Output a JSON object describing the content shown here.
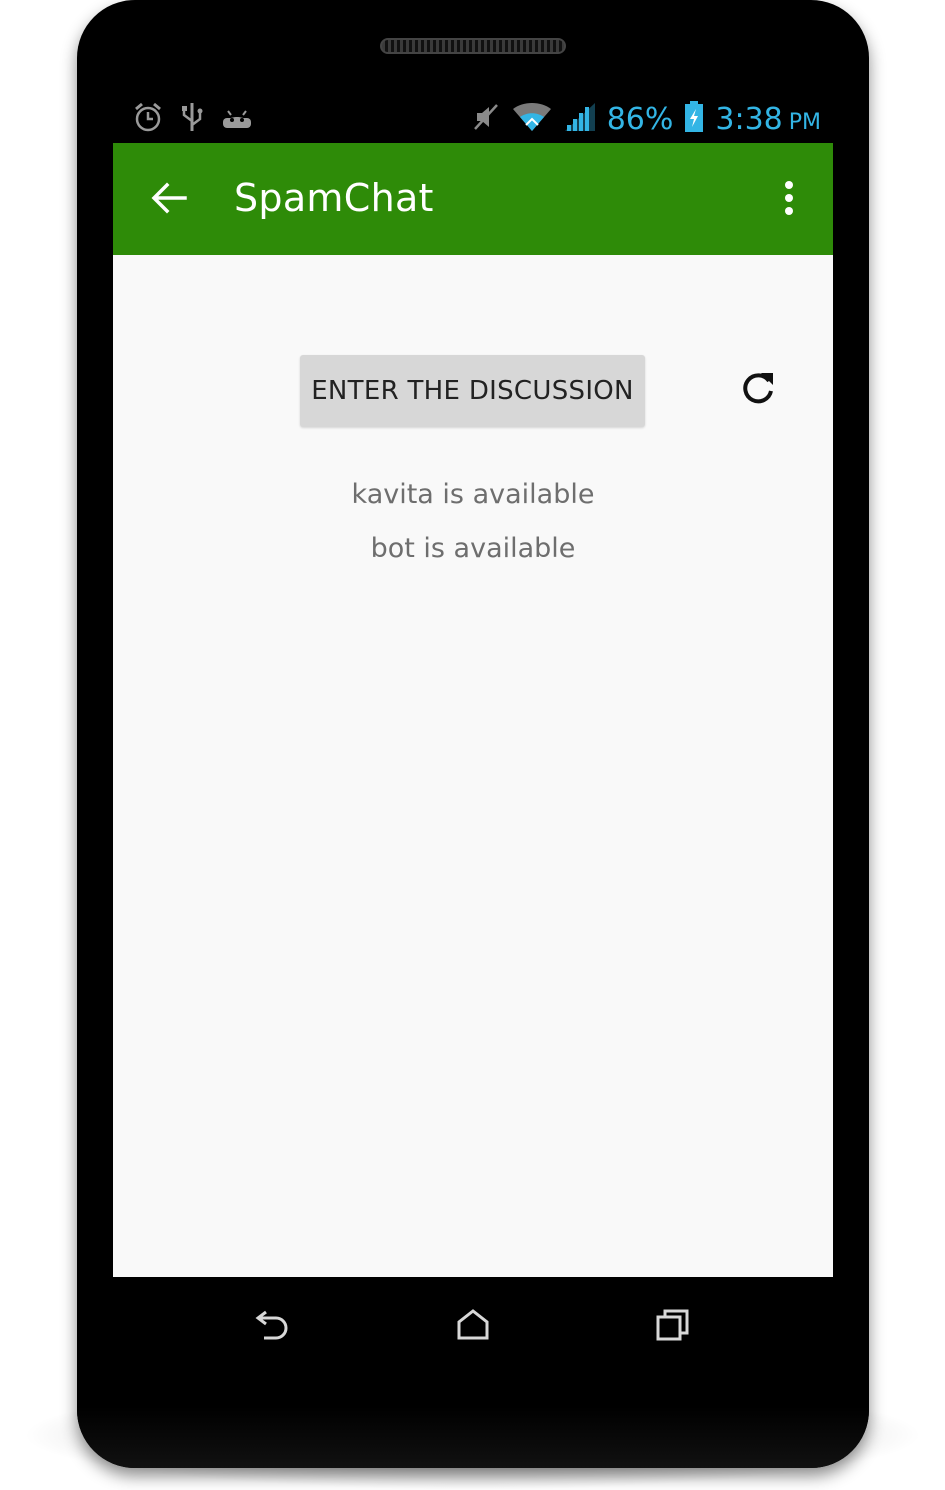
{
  "status_bar": {
    "left_icons": [
      "alarm-icon",
      "usb-icon",
      "android-debug-icon"
    ],
    "right_icons": [
      "mute-icon",
      "wifi-icon",
      "signal-icon",
      "battery-charging-icon"
    ],
    "battery_percent": "86%",
    "time": "3:38",
    "am_pm": "PM",
    "accent_color": "#33b5e5"
  },
  "app_bar": {
    "title": "SpamChat",
    "back_icon": "arrow-left-icon",
    "menu_icon": "more-vert-icon",
    "color": "#2e8b08"
  },
  "main": {
    "enter_button_label": "ENTER THE DISCUSSION",
    "refresh_icon": "refresh-icon",
    "available_users": [
      "kavita is available",
      "bot is available"
    ]
  },
  "nav_bar": {
    "icons": [
      "back-nav-icon",
      "home-icon",
      "recents-icon"
    ]
  }
}
